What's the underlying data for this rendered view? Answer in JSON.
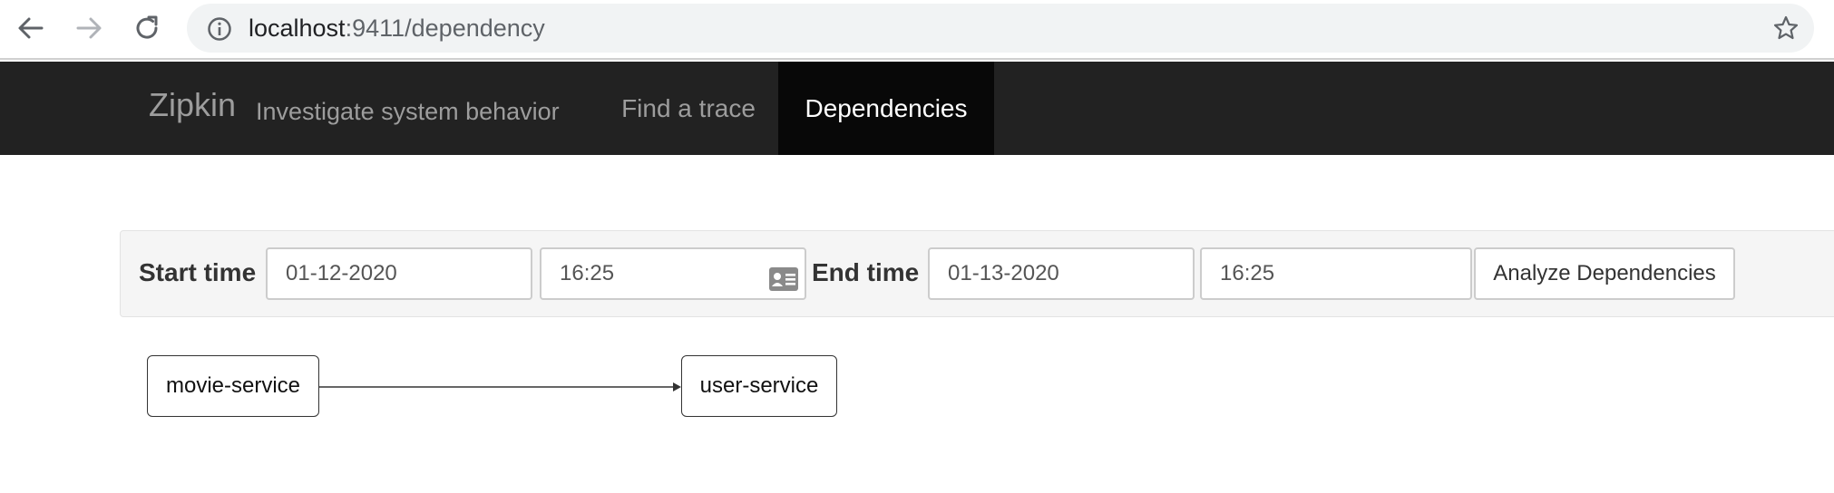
{
  "browser": {
    "url_host": "localhost",
    "url_path": ":9411/dependency"
  },
  "navbar": {
    "brand": "Zipkin",
    "tagline": "Investigate system behavior",
    "links": [
      {
        "label": "Find a trace",
        "active": false
      },
      {
        "label": "Dependencies",
        "active": true
      }
    ]
  },
  "search": {
    "start_label": "Start time",
    "start_date": "01-12-2020",
    "start_time": "16:25",
    "end_label": "End time",
    "end_date": "01-13-2020",
    "end_time": "16:25",
    "analyze_label": "Analyze Dependencies"
  },
  "graph": {
    "nodes": [
      "movie-service",
      "user-service"
    ],
    "edges": [
      {
        "from": "movie-service",
        "to": "user-service"
      }
    ]
  },
  "colors": {
    "navbar_bg": "#222222",
    "navbar_active_bg": "#080808",
    "panel_bg": "#f5f5f5"
  }
}
